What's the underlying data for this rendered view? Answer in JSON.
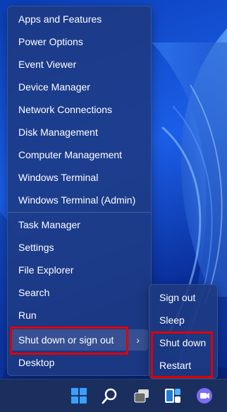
{
  "menu": {
    "items": [
      {
        "label": "Apps and Features"
      },
      {
        "label": "Power Options"
      },
      {
        "label": "Event Viewer"
      },
      {
        "label": "Device Manager"
      },
      {
        "label": "Network Connections"
      },
      {
        "label": "Disk Management"
      },
      {
        "label": "Computer Management"
      },
      {
        "label": "Windows Terminal"
      },
      {
        "label": "Windows Terminal (Admin)"
      },
      {
        "label": "Task Manager"
      },
      {
        "label": "Settings"
      },
      {
        "label": "File Explorer"
      },
      {
        "label": "Search"
      },
      {
        "label": "Run"
      },
      {
        "label": "Shut down or sign out"
      },
      {
        "label": "Desktop"
      }
    ],
    "chevron": "›"
  },
  "submenu": {
    "items": [
      {
        "label": "Sign out"
      },
      {
        "label": "Sleep"
      },
      {
        "label": "Shut down"
      },
      {
        "label": "Restart"
      }
    ]
  },
  "taskbar": {
    "icons": [
      "windows-start-icon",
      "search-icon",
      "task-view-icon",
      "widgets-icon",
      "teams-chat-icon"
    ]
  },
  "colors": {
    "highlight": "#e00000",
    "menu_bg": "#1e3a82",
    "taskbar_bg": "#1a2f5e"
  }
}
